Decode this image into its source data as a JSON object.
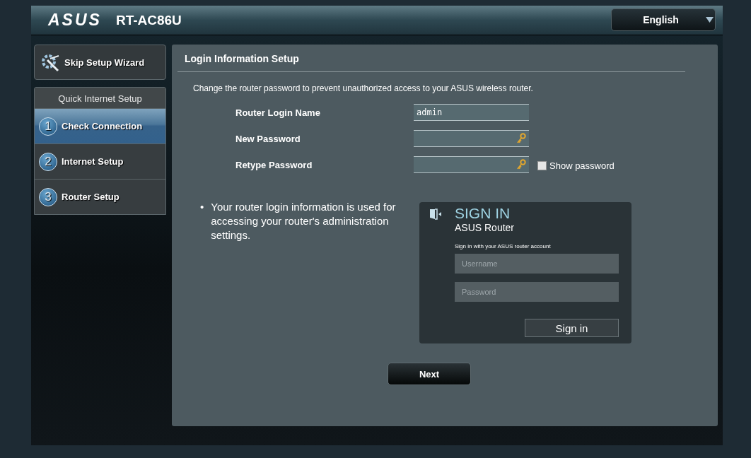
{
  "header": {
    "logo": "ASUS",
    "model": "RT-AC86U",
    "language": "English"
  },
  "sidebar": {
    "skip_button": "Skip Setup Wizard",
    "section_title": "Quick Internet Setup",
    "steps": [
      {
        "number": "1",
        "label": "Check Connection",
        "selected": true
      },
      {
        "number": "2",
        "label": "Internet Setup",
        "selected": false
      },
      {
        "number": "3",
        "label": "Router Setup",
        "selected": false
      }
    ]
  },
  "main": {
    "title": "Login Information Setup",
    "description": "Change the router password to prevent unauthorized access to your ASUS wireless router.",
    "fields": [
      {
        "label": "Router Login Name",
        "kind": "text",
        "value": "admin"
      },
      {
        "label": "New Password",
        "kind": "password"
      },
      {
        "label": "Retype Password",
        "kind": "password"
      }
    ],
    "show_password": {
      "label": "Show password",
      "checked": false
    },
    "note_bullet": "•",
    "note": "Your router login information is used for accessing your router's administration settings.",
    "sign_in_card": {
      "title": "SIGN IN",
      "subtitle": "ASUS Router",
      "hint": "Sign in with your ASUS router account",
      "username_placeholder": "Username",
      "password_placeholder": "Password",
      "button": "Sign in"
    },
    "next_button": "Next"
  }
}
